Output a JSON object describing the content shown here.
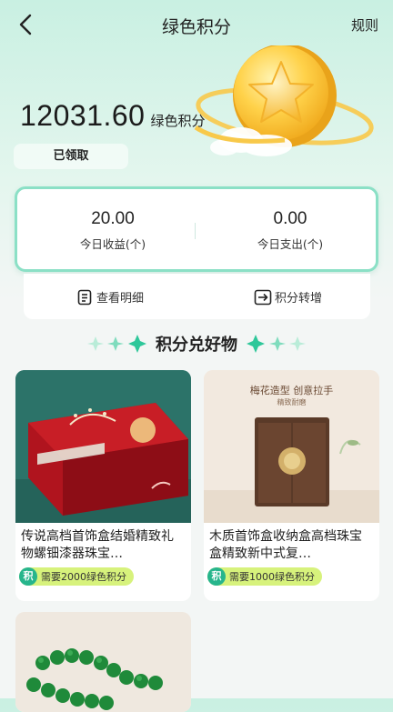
{
  "header": {
    "title": "绿色积分",
    "rules_label": "规则"
  },
  "balance": {
    "value": "12031.60",
    "unit": "绿色积分"
  },
  "claimed_label": "已领取",
  "stats": [
    {
      "value": "20.00",
      "label": "今日收益(个)"
    },
    {
      "value": "0.00",
      "label": "今日支出(个)"
    }
  ],
  "actions": {
    "details_label": "查看明细",
    "transfer_label": "积分转增"
  },
  "section_title": "积分兑好物",
  "products": [
    {
      "name": "传说高档首饰盒结婚精致礼物螺钿漆器珠宝…",
      "requirement": "需要2000绿色积分"
    },
    {
      "name": "木质首饰盒收纳盒高档珠宝盒精致新中式复…",
      "requirement": "需要1000绿色积分",
      "image_caption": "梅花造型 创意拉手",
      "image_subcaption": "精致耐磨"
    },
    {
      "name": "",
      "requirement": ""
    }
  ],
  "colors": {
    "accent_green": "#27b58c",
    "badge_lime": "#d7f27c",
    "card_border": "#8be0c6"
  }
}
